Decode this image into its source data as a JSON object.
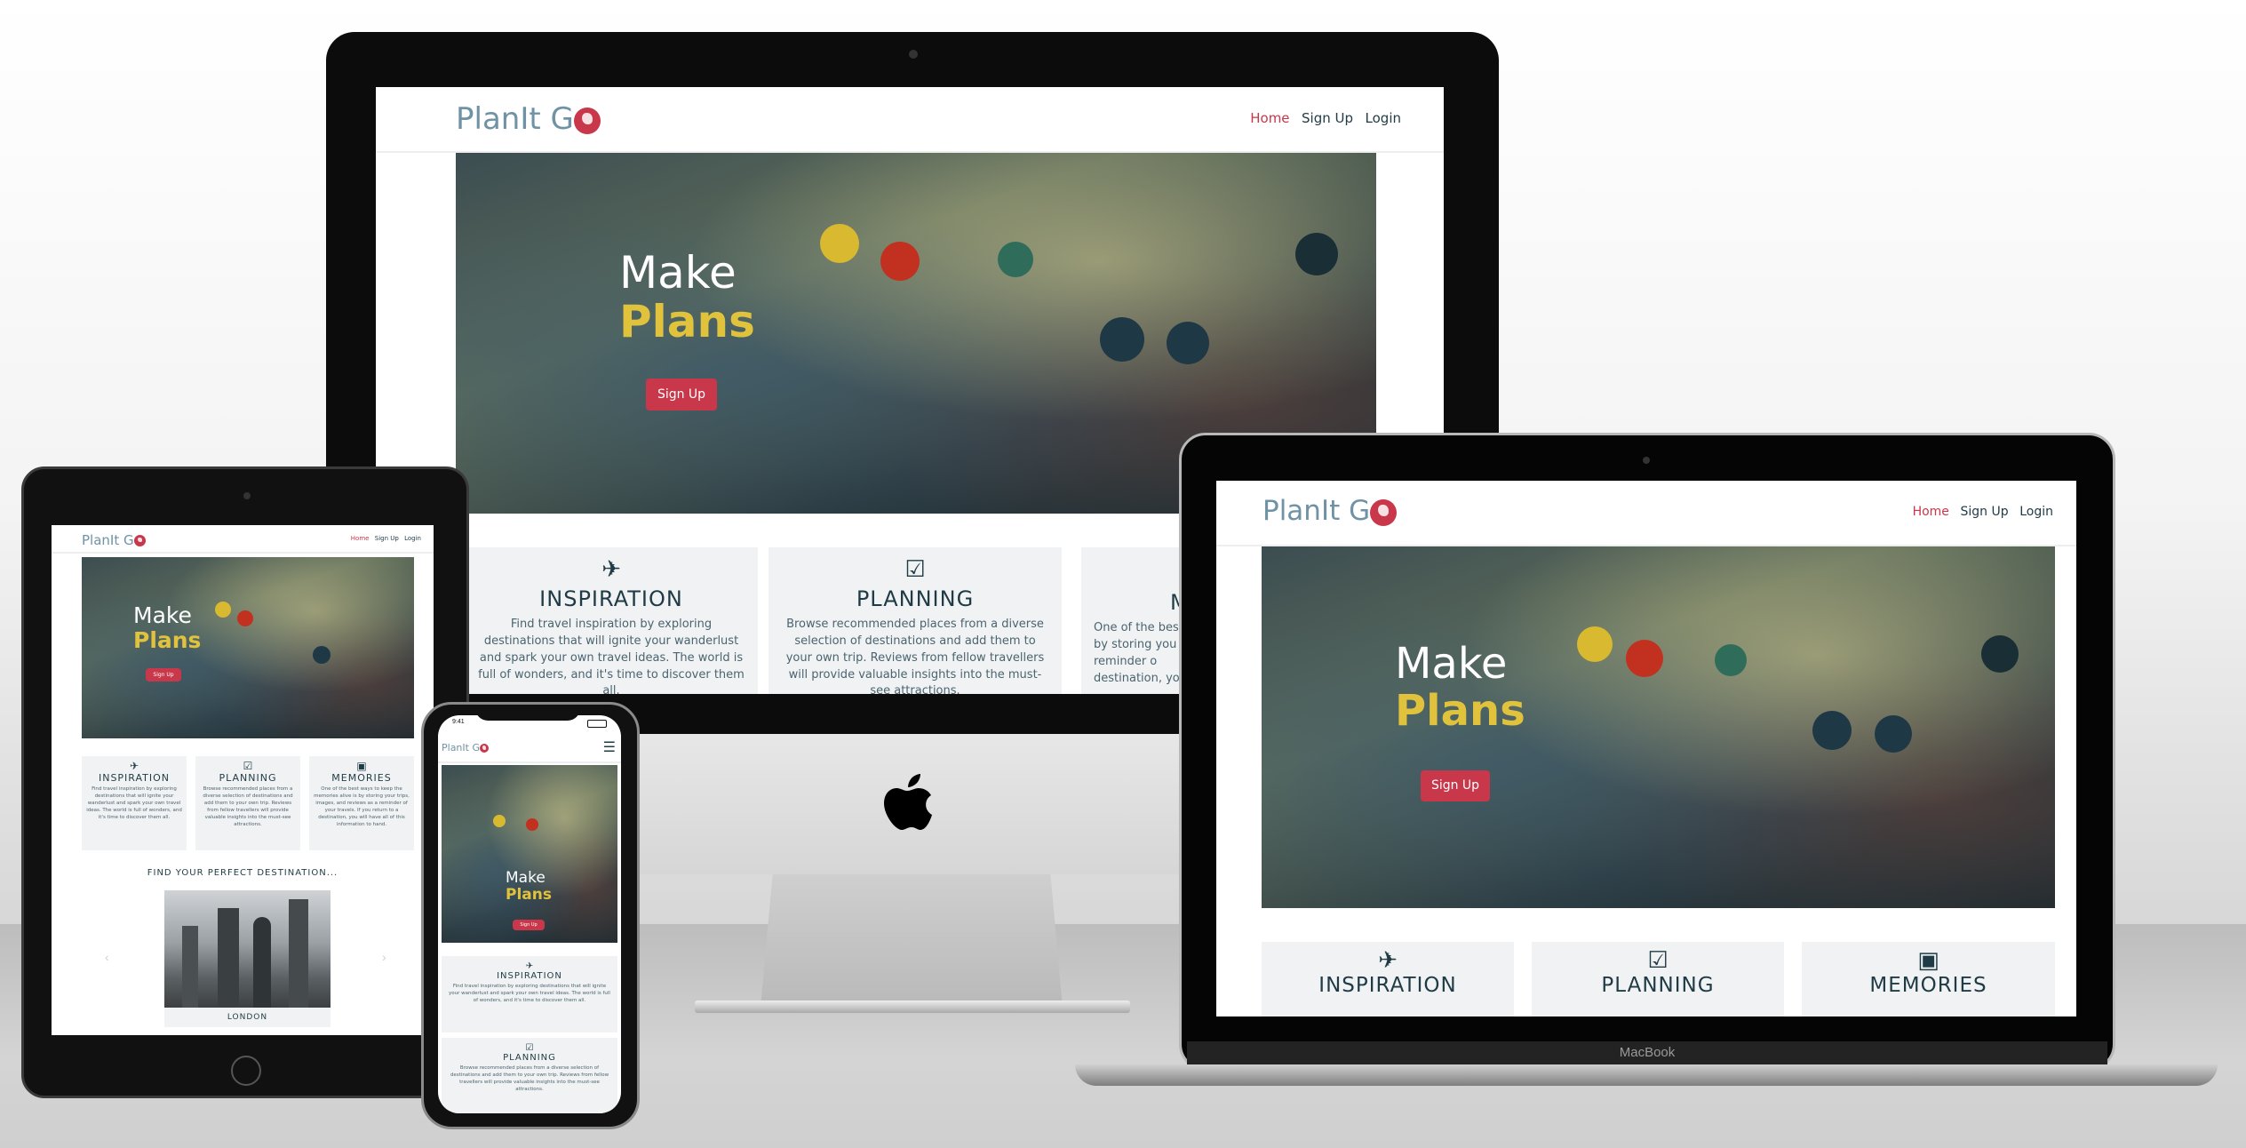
{
  "site": {
    "logo_text": "PlanIt G",
    "nav": {
      "home": "Home",
      "signup": "Sign Up",
      "login": "Login"
    },
    "hero": {
      "line1": "Make",
      "line2": "Plans",
      "button": "Sign Up"
    },
    "features": [
      {
        "icon": "plane-icon",
        "title": "INSPIRATION",
        "text": "Find travel inspiration by exploring destinations that will ignite your wanderlust and spark your own travel ideas. The world is full of wonders, and it's time to discover them all."
      },
      {
        "icon": "checklist-icon",
        "title": "PLANNING",
        "text": "Browse recommended places from a diverse selection of destinations and add them to your own trip. Reviews from fellow travellers will provide valuable insights into the must-see attractions."
      },
      {
        "icon": "camera-icon",
        "title": "MEMORIES",
        "text": "One of the best ways to keep the memories alive is by storing your trips, images, and reviews as a reminder of your travels. If you return to a destination, you will have all of this information to hand."
      }
    ],
    "imac_partial": {
      "title": "M",
      "text": "One of the best by storing you reminder o destination, you"
    },
    "destination_heading": "FIND YOUR PERFECT DESTINATION...",
    "destination_caption": "LONDON"
  },
  "phone_status": {
    "time": "9:41"
  },
  "laptop_label": "MacBook",
  "colors": {
    "accent": "#c8374a",
    "highlight": "#e0c23c",
    "text_dark": "#1f3b45",
    "logo": "#6f93a4"
  }
}
